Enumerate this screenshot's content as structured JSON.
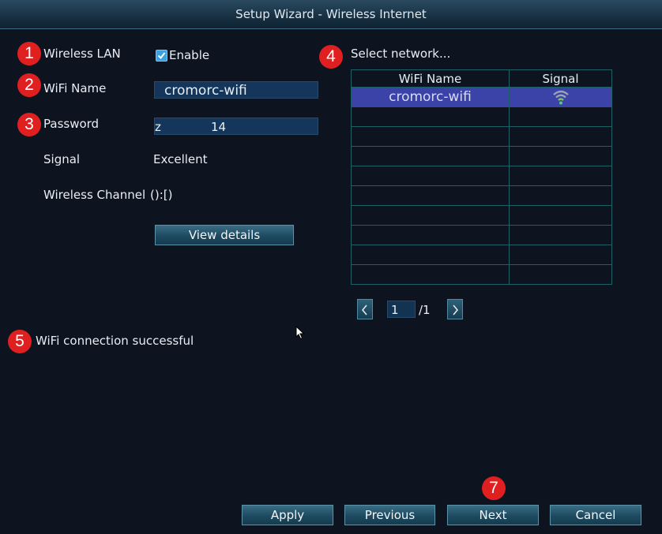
{
  "window": {
    "title": "Setup Wizard - Wireless Internet"
  },
  "markers": [
    "1",
    "2",
    "3",
    "4",
    "5",
    "7"
  ],
  "form": {
    "wireless_lan_label": "Wireless LAN",
    "enable_label": "Enable",
    "enable_checked": true,
    "wifi_name_label": "WiFi Name",
    "wifi_name_value": "cromorc-wifi",
    "password_label": "Password",
    "password_prefix": "z",
    "password_suffix": "14",
    "signal_label": "Signal",
    "signal_value": "Excellent",
    "channel_label": "Wireless Channel",
    "channel_value": "():[)",
    "view_details_label": "View details"
  },
  "network_list": {
    "title": "Select network...",
    "columns": [
      "WiFi Name",
      "Signal"
    ],
    "rows": [
      {
        "name": "cromorc-wifi",
        "signal_icon": "wifi-signal-icon",
        "selected": true
      }
    ],
    "empty_rows": 9
  },
  "pagination": {
    "prev_icon": "chevron-left-icon",
    "current": "1",
    "total": "/1",
    "next_icon": "chevron-right-icon"
  },
  "status": {
    "message": "WiFi connection successful"
  },
  "footer": {
    "apply_label": "Apply",
    "previous_label": "Previous",
    "next_label": "Next",
    "cancel_label": "Cancel"
  },
  "colors": {
    "accent": "#3b42a8",
    "badge": "#e02020",
    "button": "#1d4a60"
  }
}
